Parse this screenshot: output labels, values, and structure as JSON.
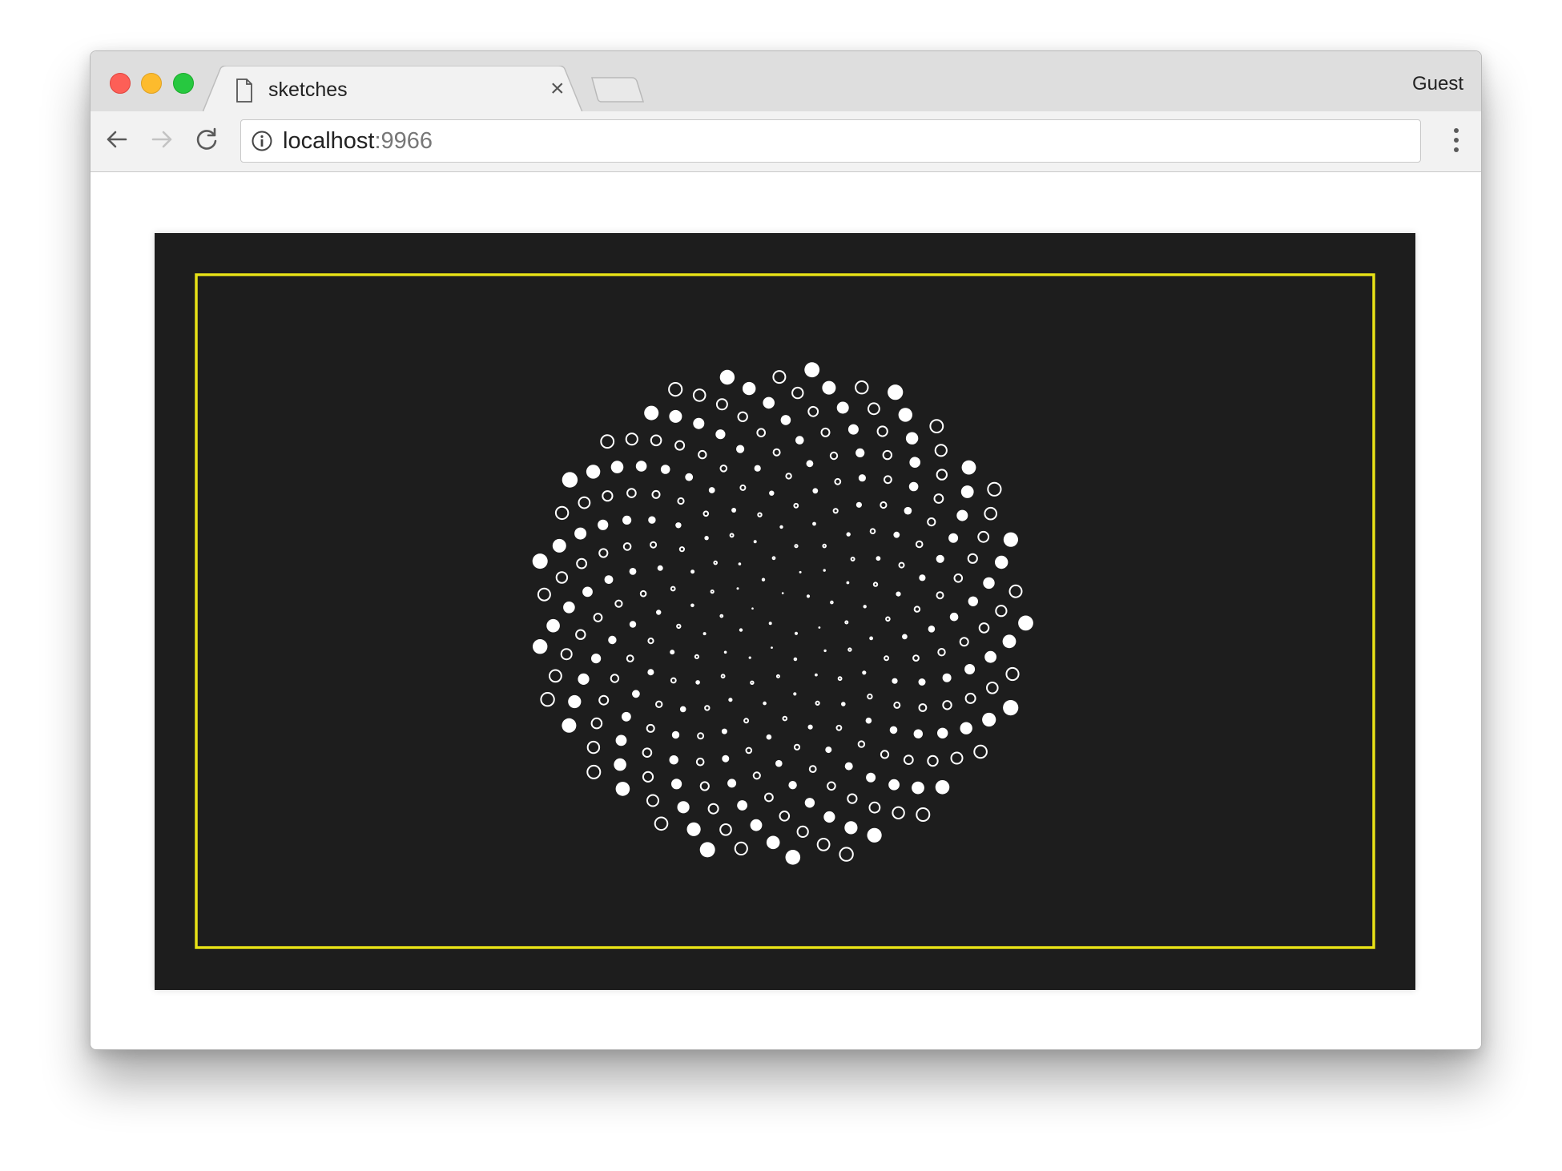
{
  "window": {
    "traffic_lights": [
      "close",
      "minimize",
      "maximize"
    ]
  },
  "tab": {
    "title": "sketches",
    "close_symbol": "×",
    "icon": "document-icon"
  },
  "profile": {
    "label": "Guest"
  },
  "toolbar": {
    "back_icon": "arrow-left-icon",
    "forward_icon": "arrow-right-icon",
    "reload_icon": "reload-icon",
    "menu_icon": "three-dots-vertical-icon"
  },
  "address_bar": {
    "host": "localhost",
    "port": ":9966",
    "security_icon": "info-icon"
  },
  "sketch": {
    "background_color": "#1d1d1d",
    "frame_color": "#e6e016",
    "dot_color": "#ffffff",
    "pattern": "phyllotaxis spiral of alternating filled and outlined circles"
  }
}
